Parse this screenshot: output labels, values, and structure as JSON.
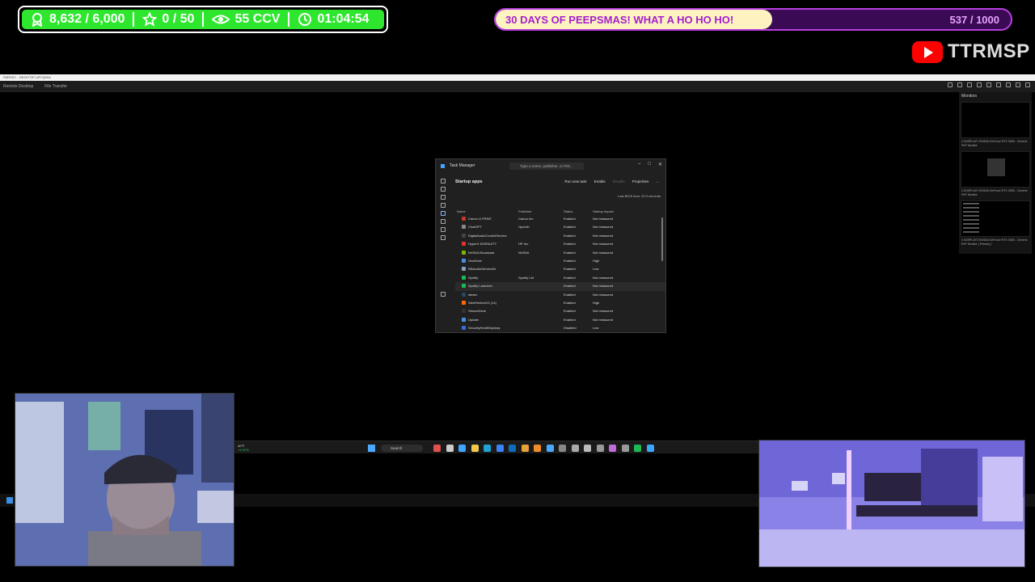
{
  "overlay": {
    "followers": "8,632 / 6,000",
    "subs": "0 / 50",
    "viewers": "55 CCV",
    "uptime": "01:04:54",
    "goal_title": "30 DAYS OF PEEPSMAS! WHAT A HO HO HO!",
    "goal_count": "537 / 1000",
    "goal_progress": 0.537,
    "channel_name": "TTRMSP"
  },
  "remote_app": {
    "title": "PARSEC - DESKTOP-UR7QN0A",
    "tabs": [
      "Remote Desktop",
      "File Transfer"
    ],
    "monitors_title": "Monitors",
    "monitors": [
      "\\\\.\\DISPLAY1 NVIDIA GeForce RTX 3050 - Generic PnP Monitor",
      "\\\\.\\DISPLAY2 NVIDIA GeForce RTX 3050 - Generic PnP Monitor",
      "\\\\.\\DISPLAY3 NVIDIA GeForce RTX 3050 - Generic PnP Monitor ( Primary )"
    ]
  },
  "task_manager": {
    "title": "Task Manager",
    "search_placeholder": "Type a name, publisher, or PID...",
    "section": "Startup apps",
    "actions": {
      "run_new_task": "Run new task",
      "enable": "Enable",
      "disable": "Disable",
      "properties": "Properties",
      "more": "..."
    },
    "bios": "Last BIOS time: 20.0 seconds",
    "columns": [
      "Name",
      "Publisher",
      "Status",
      "Startup impact"
    ],
    "rows": [
      {
        "name": "Canon IJ PRINT",
        "publisher": "Canon Inc.",
        "status": "Enabled",
        "impact": "Not measured",
        "color": "#c0392b"
      },
      {
        "name": "ChatGPT",
        "publisher": "OpenAI",
        "status": "Enabled",
        "impact": "Not measured",
        "color": "#888888"
      },
      {
        "name": "DigitalAudioControlService",
        "publisher": "",
        "status": "Enabled",
        "impact": "Not measured",
        "color": "#444444"
      },
      {
        "name": "HyperX NGENUITY",
        "publisher": "HP Inc.",
        "status": "Enabled",
        "impact": "Not measured",
        "color": "#e03131"
      },
      {
        "name": "NVIDIA Broadcast",
        "publisher": "NVIDIA",
        "status": "Enabled",
        "impact": "Not measured",
        "color": "#76b900"
      },
      {
        "name": "OneDrive",
        "publisher": "",
        "status": "Enabled",
        "impact": "High",
        "color": "#4a90e2"
      },
      {
        "name": "RtkAudioService64",
        "publisher": "",
        "status": "Enabled",
        "impact": "Low",
        "color": "#8aa0c0"
      },
      {
        "name": "Spotify",
        "publisher": "Spotify Ltd",
        "status": "Enabled",
        "impact": "Not measured",
        "color": "#1db954"
      },
      {
        "name": "Spotify Launcher",
        "publisher": "",
        "status": "Enabled",
        "impact": "Not measured",
        "color": "#1db954"
      },
      {
        "name": "steam",
        "publisher": "",
        "status": "Enabled",
        "impact": "Not measured",
        "color": "#2a475e"
      },
      {
        "name": "SteelSeriesGG (14)",
        "publisher": "",
        "status": "Enabled",
        "impact": "High",
        "color": "#ff6a00"
      },
      {
        "name": "StreamDeck",
        "publisher": "",
        "status": "Enabled",
        "impact": "Not measured",
        "color": "#333333"
      },
      {
        "name": "Update",
        "publisher": "",
        "status": "Enabled",
        "impact": "Not measured",
        "color": "#4a90e2"
      },
      {
        "name": "SecurityHealthSystray",
        "publisher": "",
        "status": "Disabled",
        "impact": "Low",
        "color": "#2f6fd6"
      }
    ]
  },
  "taskbar": {
    "weather_temp": "40°F",
    "weather_desc": "+1.97%",
    "search": "Search",
    "apps": [
      {
        "name": "widgets-icon",
        "color": "#e05050"
      },
      {
        "name": "taskview-icon",
        "color": "#cccccc"
      },
      {
        "name": "copilot-icon",
        "color": "#3ea6ff"
      },
      {
        "name": "explorer-icon",
        "color": "#f2c94c"
      },
      {
        "name": "edge-icon",
        "color": "#1fa3d6"
      },
      {
        "name": "store-icon",
        "color": "#3b82f6"
      },
      {
        "name": "outlook-icon",
        "color": "#0f6cbd"
      },
      {
        "name": "chrome-icon",
        "color": "#e8a23a"
      },
      {
        "name": "vlc-icon",
        "color": "#f28c28"
      },
      {
        "name": "app-icon-1",
        "color": "#4aa8ff"
      },
      {
        "name": "app-icon-2",
        "color": "#888888"
      },
      {
        "name": "app-icon-3",
        "color": "#aaaaaa"
      },
      {
        "name": "settings-icon",
        "color": "#bbbbbb"
      },
      {
        "name": "app-icon-4",
        "color": "#999999"
      },
      {
        "name": "app-icon-5",
        "color": "#c06bd8"
      },
      {
        "name": "app-icon-6",
        "color": "#999999"
      },
      {
        "name": "spotify-icon",
        "color": "#1db954"
      },
      {
        "name": "taskmanager-icon",
        "color": "#3ea6ff"
      }
    ]
  },
  "colors": {
    "stats_green": "#2ee62e",
    "goal_purple": "#b83fe0",
    "youtube_red": "#ff0000"
  }
}
